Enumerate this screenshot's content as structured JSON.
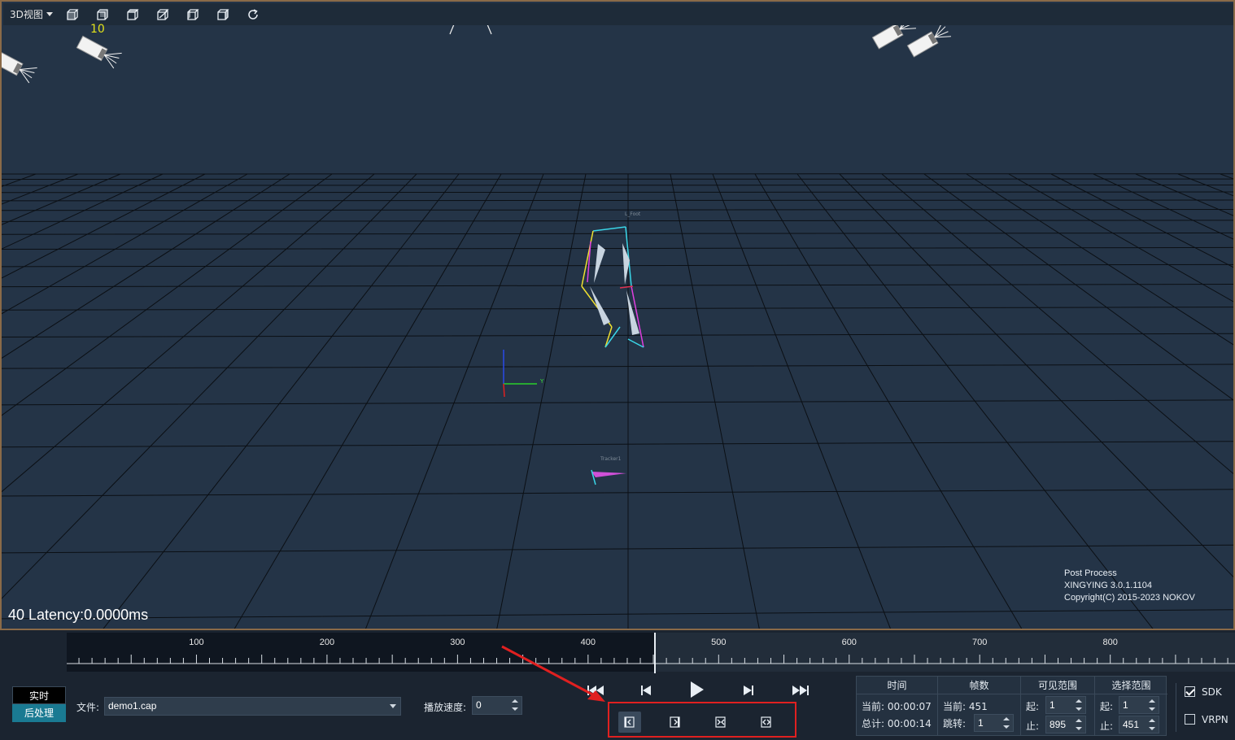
{
  "toolbar": {
    "view_selector": "3D视图",
    "buttons": [
      "cube-front-icon",
      "cube-back-icon",
      "cube-top-icon",
      "cube-bottom-icon",
      "cube-left-icon",
      "cube-right-icon",
      "refresh-icon"
    ]
  },
  "viewport": {
    "camera_label": "10",
    "latency": "40 Latency:0.0000ms",
    "info_lines": [
      "Post Process",
      "XINGYING 3.0.1.1104",
      "Copyright(C) 2015-2023 NOKOV"
    ],
    "skeleton_label": "L_Foot",
    "tracker_label": "Tracker1",
    "axis_y": "Y",
    "colors": {
      "background": "#243447",
      "grid": "#0b0f14",
      "camera_label": "#e2e21a"
    }
  },
  "timeline": {
    "tick_labels": [
      "100",
      "200",
      "300",
      "400",
      "500",
      "600",
      "700",
      "800"
    ],
    "current_frame": 451,
    "frame_range": [
      0,
      895
    ]
  },
  "mode": {
    "live_label": "实时",
    "post_label": "后处理"
  },
  "file": {
    "label": "文件:",
    "value": "demo1.cap"
  },
  "speed": {
    "label": "播放速度:",
    "value": "0"
  },
  "playback_buttons": [
    "skip-to-start-icon",
    "step-back-icon",
    "play-icon",
    "step-forward-icon",
    "skip-to-end-icon"
  ],
  "range_buttons": [
    "set-range-start-icon",
    "set-range-end-icon",
    "clear-range-icon",
    "select-range-icon"
  ],
  "stats": {
    "time": {
      "header": "时间",
      "current_label": "当前:",
      "current_value": "00:00:07",
      "total_label": "总计:",
      "total_value": "00:00:14"
    },
    "frames": {
      "header": "帧数",
      "current_label": "当前:",
      "current_value": "451",
      "jump_label": "跳转:",
      "jump_value": "1"
    },
    "visible_range": {
      "header": "可见范围",
      "start_label": "起:",
      "start_value": "1",
      "end_label": "止:",
      "end_value": "895"
    },
    "select_range": {
      "header": "选择范围",
      "start_label": "起:",
      "start_value": "1",
      "end_label": "止:",
      "end_value": "451"
    }
  },
  "outputs": {
    "sdk_label": "SDK",
    "sdk_checked": true,
    "vrpn_label": "VRPN",
    "vrpn_checked": false
  }
}
